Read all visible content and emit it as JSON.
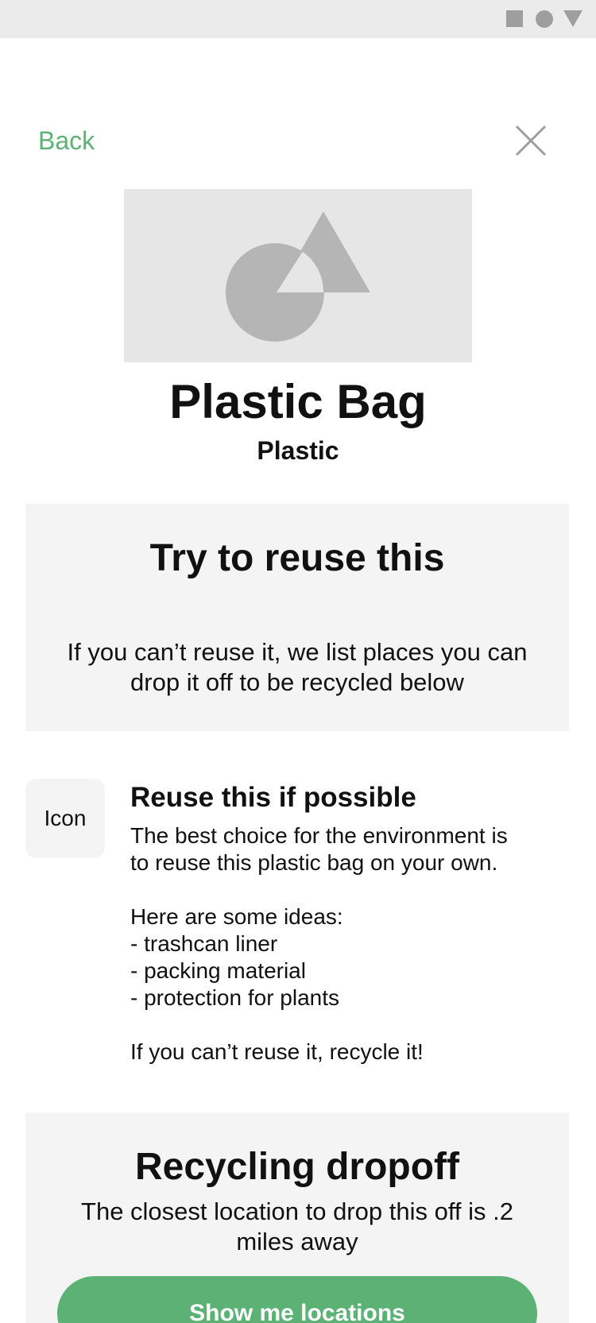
{
  "theme": {
    "accent": "#5cb275",
    "card_background": "#f4f4f4",
    "status_bar": "#ebebeb"
  },
  "status_bar": {
    "icons": [
      "square-icon",
      "circle-icon",
      "triangle-icon"
    ]
  },
  "nav": {
    "back_label": "Back",
    "close_icon": "close-icon"
  },
  "hero": {
    "image": "image-placeholder-icon"
  },
  "item": {
    "title": "Plastic Bag",
    "category": "Plastic"
  },
  "reuse_card": {
    "heading": "Try to reuse this",
    "text": "If you can’t reuse it, we list places you can drop it off to be recycled below"
  },
  "tip": {
    "icon_label": "Icon",
    "heading": "Reuse this if possible",
    "lines": [
      "The best choice for the environment is",
      "to reuse this plastic bag on your own.",
      "",
      "Here are some ideas:",
      "- trashcan liner",
      "- packing material",
      "- protection for plants",
      "",
      "If you can’t reuse it, recycle it!"
    ]
  },
  "dropoff_card": {
    "heading": "Recycling dropoff",
    "text": "The closest location to drop this off is .2 miles away",
    "button_label": "Show me locations"
  }
}
